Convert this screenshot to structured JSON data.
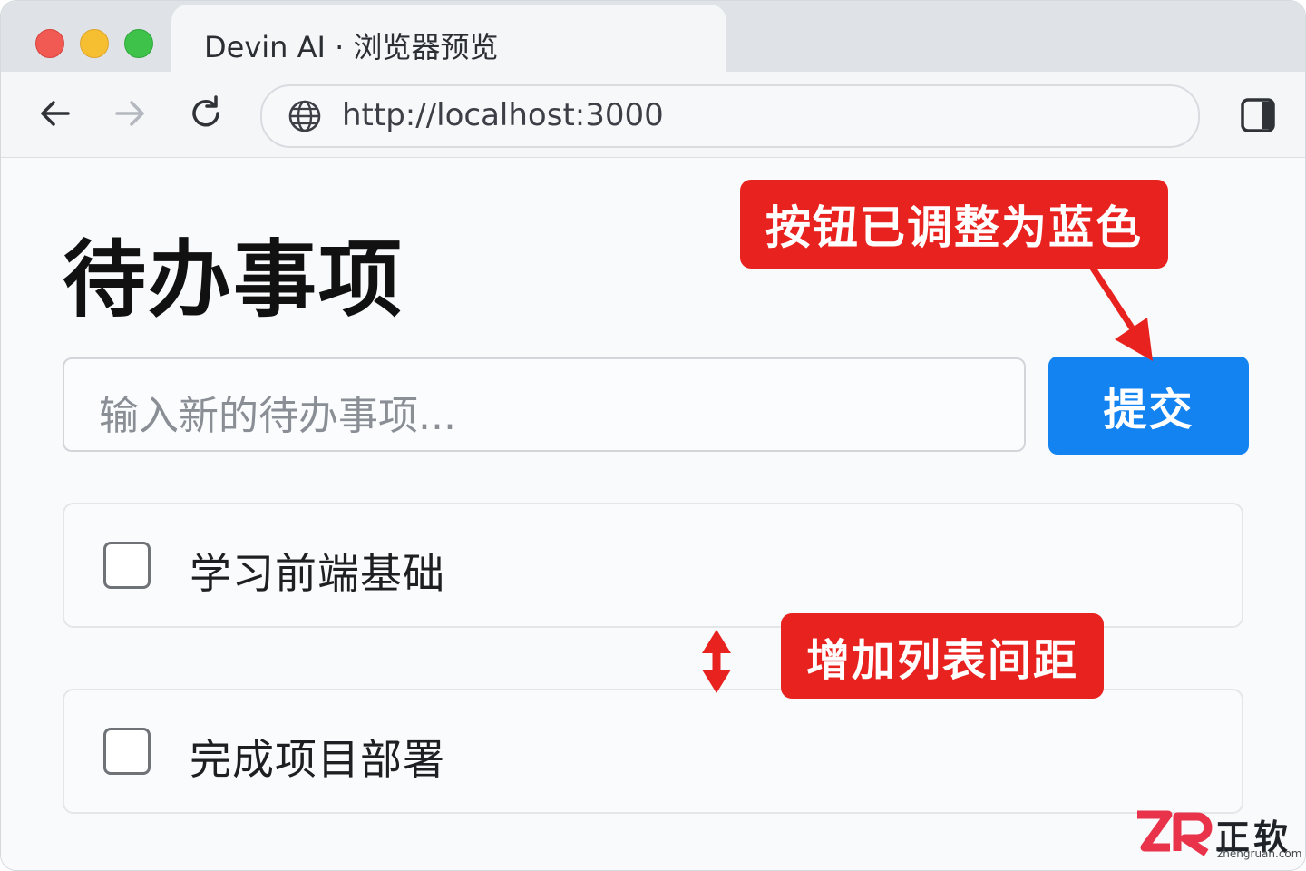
{
  "browser": {
    "tab_title": "Devin AI · 浏览器预览",
    "url": "http://localhost:3000"
  },
  "page": {
    "title": "待办事项",
    "input_placeholder": "输入新的待办事项...",
    "submit_label": "提交",
    "todos": [
      {
        "label": "学习前端基础",
        "checked": false
      },
      {
        "label": "完成项目部署",
        "checked": false
      }
    ]
  },
  "annotations": {
    "button_note": "按钮已调整为蓝色",
    "spacing_note": "增加列表间距"
  },
  "watermark": {
    "name": "正软",
    "domain": "zhengruan.com"
  },
  "colors": {
    "submit_button": "#1283f0",
    "annotation": "#e8221f",
    "close_light": "#f05a52",
    "minimize_light": "#f6be31",
    "zoom_light": "#3ec24a"
  },
  "icons": [
    "back-arrow-icon",
    "forward-arrow-icon",
    "reload-icon",
    "globe-icon",
    "sidebar-toggle-icon",
    "vertical-double-arrow-icon",
    "annotation-arrow-icon"
  ]
}
